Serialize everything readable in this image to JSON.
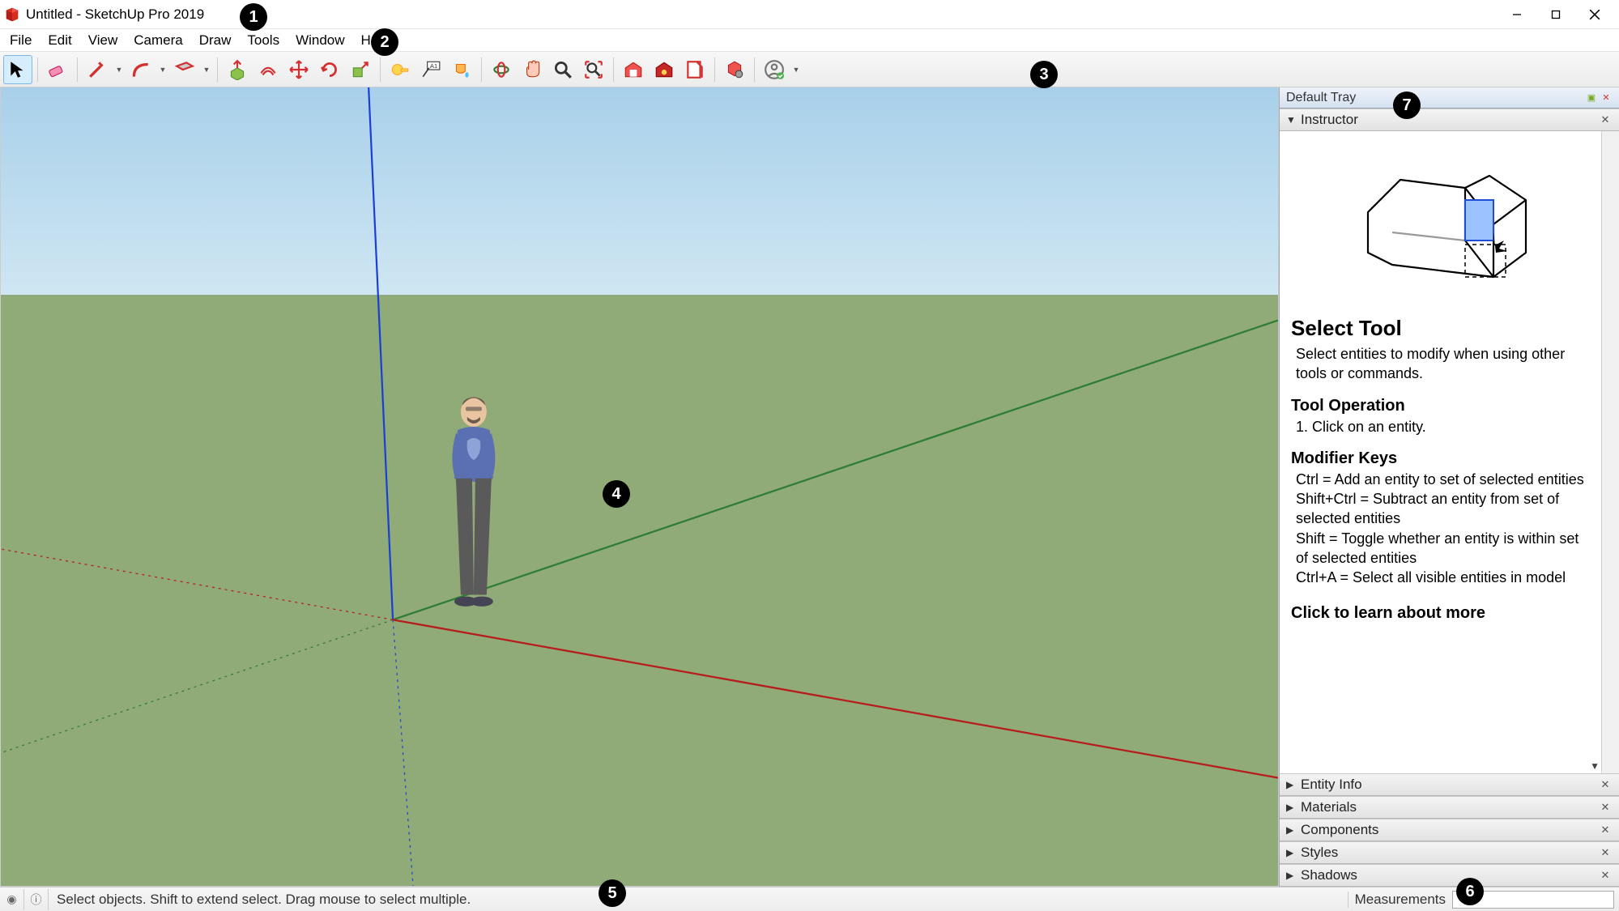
{
  "titlebar": {
    "title": "Untitled - SketchUp Pro 2019"
  },
  "menu": {
    "file": "File",
    "edit": "Edit",
    "view": "View",
    "camera": "Camera",
    "draw": "Draw",
    "tools": "Tools",
    "window": "Window",
    "help": "Help"
  },
  "toolbar": {
    "select": "Select",
    "eraser": "Eraser",
    "line": "Line",
    "arc": "Arc",
    "rectangle": "Rectangle",
    "pushpull": "Push/Pull",
    "offset": "Offset",
    "move": "Move",
    "rotate": "Rotate",
    "scale": "Scale",
    "tape": "Tape Measure",
    "text": "Text",
    "paint": "Paint Bucket",
    "orbit": "Orbit",
    "pan": "Pan",
    "zoom": "Zoom",
    "zoomext": "Zoom Extents",
    "warehouse": "3D Warehouse",
    "extwarehouse": "Extension Warehouse",
    "layout": "LayOut",
    "extmgr": "Extension Manager",
    "signin": "Sign In"
  },
  "tray": {
    "title": "Default Tray",
    "instructor": {
      "label": "Instructor",
      "tool_title": "Select Tool",
      "tool_desc": "Select entities to modify when using other tools or commands.",
      "op_head": "Tool Operation",
      "op_step1": "1. Click on an entity.",
      "mod_head": "Modifier Keys",
      "mod1": "Ctrl = Add an entity to set of selected entities",
      "mod2": "Shift+Ctrl = Subtract an entity from set of selected entities",
      "mod3": "Shift = Toggle whether an entity is within set of selected entities",
      "mod4": "Ctrl+A = Select all visible entities in model",
      "learn_more": "Click to learn about more"
    },
    "panels": {
      "entity": "Entity Info",
      "materials": "Materials",
      "components": "Components",
      "styles": "Styles",
      "shadows": "Shadows"
    }
  },
  "status": {
    "hint": "Select objects. Shift to extend select. Drag mouse to select multiple.",
    "measurements_label": "Measurements",
    "measurements_value": ""
  },
  "callouts": {
    "1": "1",
    "2": "2",
    "3": "3",
    "4": "4",
    "5": "5",
    "6": "6",
    "7": "7"
  }
}
